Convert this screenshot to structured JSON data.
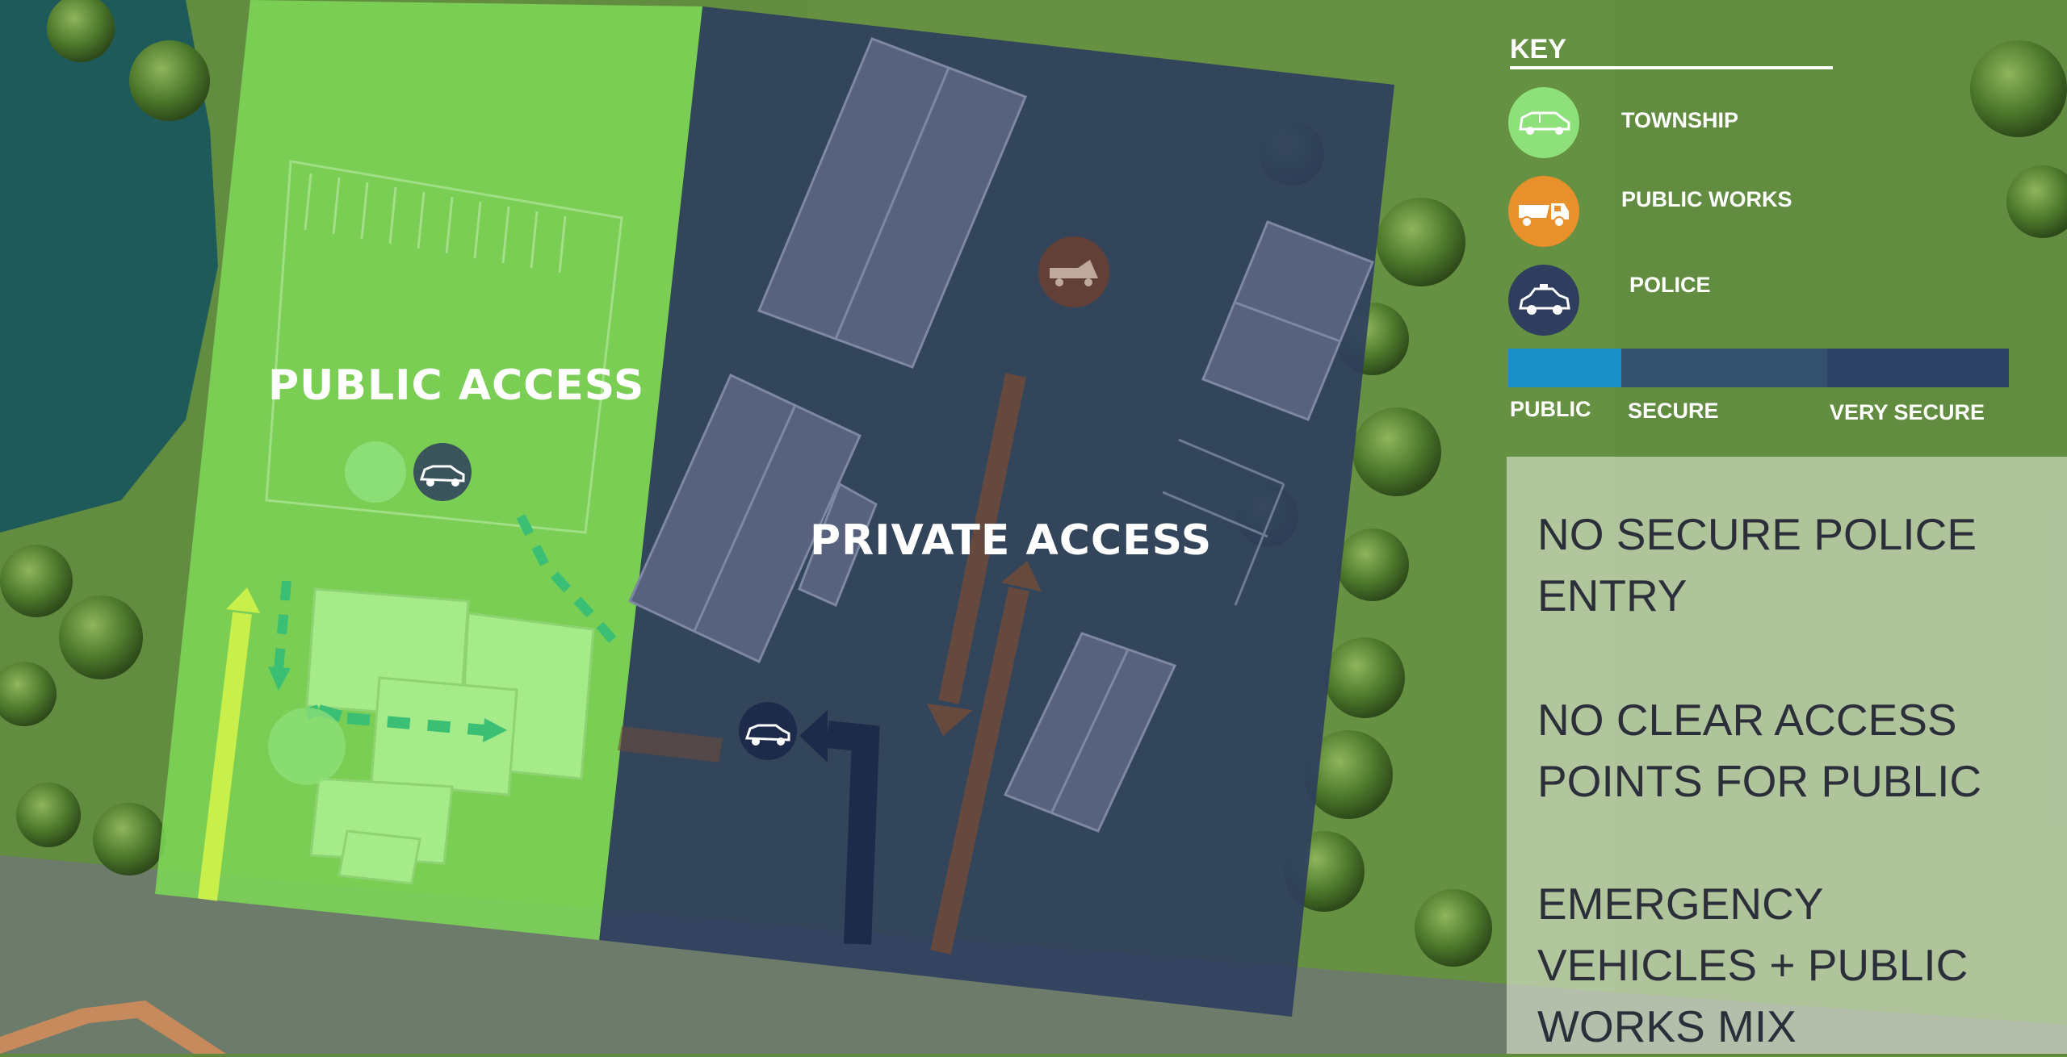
{
  "zones": {
    "public_label": "PUBLIC ACCESS",
    "private_label": "PRIVATE ACCESS",
    "public_color": "#7ed957",
    "private_color": "#2d3d5e"
  },
  "key": {
    "title": "KEY",
    "items": [
      {
        "label": "TOWNSHIP",
        "icon": "suv-icon",
        "color": "#8ee07a"
      },
      {
        "label": "PUBLIC WORKS",
        "icon": "dump-truck-icon",
        "color": "#e8902c"
      },
      {
        "label": "POLICE",
        "icon": "police-car-icon",
        "color": "#2f3e5e"
      }
    ],
    "security_scale": [
      {
        "label": "PUBLIC",
        "color": "#1a90c8"
      },
      {
        "label": "SECURE",
        "color": "#34506f"
      },
      {
        "label": "VERY SECURE",
        "color": "#2f4268"
      }
    ]
  },
  "notes": [
    "NO SECURE POLICE ENTRY",
    "NO CLEAR ACCESS POINTS FOR PUBLIC",
    "EMERGENCY VEHICLES + PUBLIC WORKS MIX"
  ]
}
